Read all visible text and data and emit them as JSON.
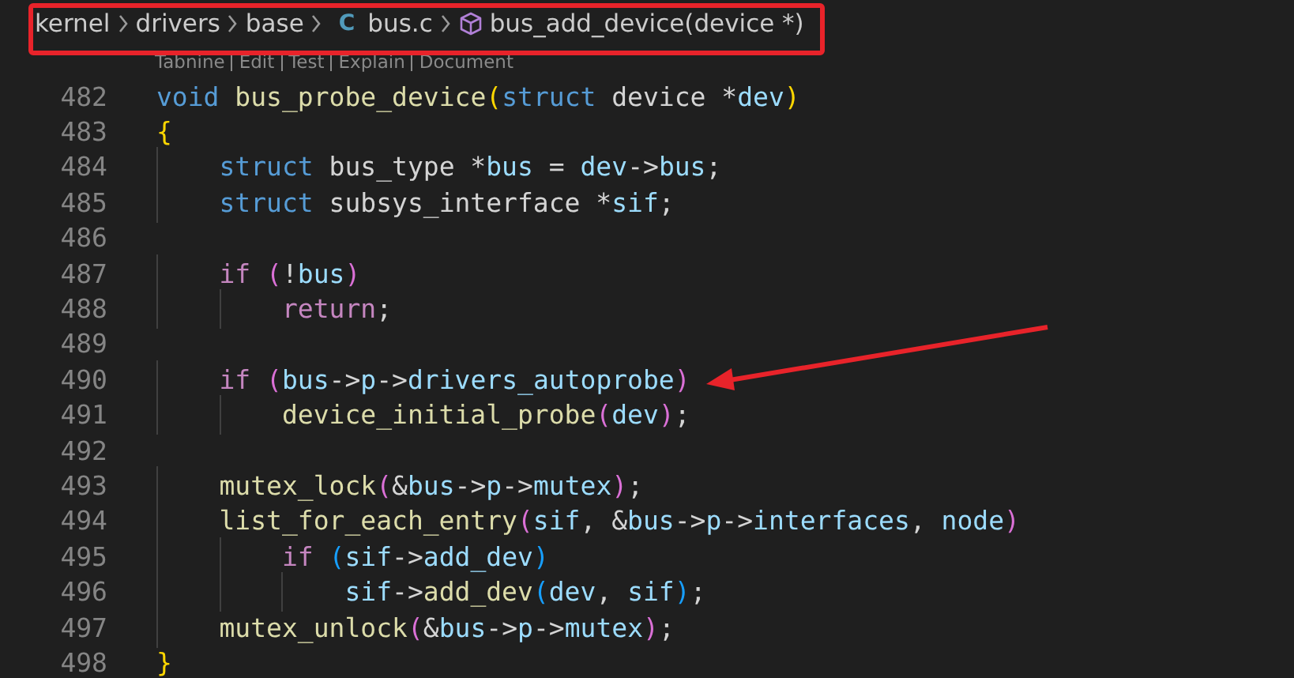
{
  "breadcrumb": [
    {
      "kind": "folder",
      "label": "kernel"
    },
    {
      "kind": "folder",
      "label": "drivers"
    },
    {
      "kind": "folder",
      "label": "base"
    },
    {
      "kind": "c-file",
      "glyph": "C",
      "label": "bus.c"
    },
    {
      "kind": "symbol",
      "label": "bus_add_device(device *)"
    }
  ],
  "codelens": [
    "Tabnine",
    "Edit",
    "Test",
    "Explain",
    "Document"
  ],
  "code_lines": [
    {
      "number": "482",
      "tokens": [
        {
          "kind": "keyword",
          "text": "void"
        },
        {
          "kind": "function",
          "text": " bus_probe_device"
        },
        {
          "kind": "bracket1",
          "text": "("
        },
        {
          "kind": "keyword",
          "text": "struct"
        },
        {
          "kind": "plain",
          "text": " device *"
        },
        {
          "kind": "variable",
          "text": "dev"
        },
        {
          "kind": "bracket1",
          "text": ")"
        }
      ]
    },
    {
      "number": "483",
      "tokens": [
        {
          "kind": "bracket1",
          "text": "{"
        }
      ]
    },
    {
      "number": "484",
      "tokens": [
        {
          "kind": "keyword",
          "text": "    struct"
        },
        {
          "kind": "plain",
          "text": " bus_type *"
        },
        {
          "kind": "variable",
          "text": "bus"
        },
        {
          "kind": "plain",
          "text": " = "
        },
        {
          "kind": "variable",
          "text": "dev"
        },
        {
          "kind": "plain",
          "text": "->"
        },
        {
          "kind": "variable",
          "text": "bus"
        },
        {
          "kind": "plain",
          "text": ";"
        }
      ]
    },
    {
      "number": "485",
      "tokens": [
        {
          "kind": "keyword",
          "text": "    struct"
        },
        {
          "kind": "plain",
          "text": " subsys_interface *"
        },
        {
          "kind": "variable",
          "text": "sif"
        },
        {
          "kind": "plain",
          "text": ";"
        }
      ]
    },
    {
      "number": "486"
    },
    {
      "number": "487",
      "tokens": [
        {
          "kind": "control",
          "text": "    if"
        },
        {
          "kind": "bracket2",
          "text": " ("
        },
        {
          "kind": "plain",
          "text": "!"
        },
        {
          "kind": "variable",
          "text": "bus"
        },
        {
          "kind": "bracket2",
          "text": ")"
        }
      ]
    },
    {
      "number": "488",
      "tokens": [
        {
          "kind": "control",
          "text": "        return"
        },
        {
          "kind": "plain",
          "text": ";"
        }
      ]
    },
    {
      "number": "489"
    },
    {
      "number": "490",
      "tokens": [
        {
          "kind": "control",
          "text": "    if"
        },
        {
          "kind": "bracket2",
          "text": " ("
        },
        {
          "kind": "variable",
          "text": "bus"
        },
        {
          "kind": "plain",
          "text": "->"
        },
        {
          "kind": "variable",
          "text": "p"
        },
        {
          "kind": "plain",
          "text": "->"
        },
        {
          "kind": "variable",
          "text": "drivers_autoprobe"
        },
        {
          "kind": "bracket2",
          "text": ")"
        }
      ]
    },
    {
      "number": "491",
      "tokens": [
        {
          "kind": "function",
          "text": "        device_initial_probe"
        },
        {
          "kind": "bracket2",
          "text": "("
        },
        {
          "kind": "variable",
          "text": "dev"
        },
        {
          "kind": "bracket2",
          "text": ")"
        },
        {
          "kind": "plain",
          "text": ";"
        }
      ]
    },
    {
      "number": "492"
    },
    {
      "number": "493",
      "tokens": [
        {
          "kind": "function",
          "text": "    mutex_lock"
        },
        {
          "kind": "bracket2",
          "text": "("
        },
        {
          "kind": "plain",
          "text": "&"
        },
        {
          "kind": "variable",
          "text": "bus"
        },
        {
          "kind": "plain",
          "text": "->"
        },
        {
          "kind": "variable",
          "text": "p"
        },
        {
          "kind": "plain",
          "text": "->"
        },
        {
          "kind": "variable",
          "text": "mutex"
        },
        {
          "kind": "bracket2",
          "text": ")"
        },
        {
          "kind": "plain",
          "text": ";"
        }
      ]
    },
    {
      "number": "494",
      "tokens": [
        {
          "kind": "function",
          "text": "    list_for_each_entry"
        },
        {
          "kind": "bracket2",
          "text": "("
        },
        {
          "kind": "variable",
          "text": "sif"
        },
        {
          "kind": "plain",
          "text": ", &"
        },
        {
          "kind": "variable",
          "text": "bus"
        },
        {
          "kind": "plain",
          "text": "->"
        },
        {
          "kind": "variable",
          "text": "p"
        },
        {
          "kind": "plain",
          "text": "->"
        },
        {
          "kind": "variable",
          "text": "interfaces"
        },
        {
          "kind": "plain",
          "text": ", "
        },
        {
          "kind": "variable",
          "text": "node"
        },
        {
          "kind": "bracket2",
          "text": ")"
        }
      ]
    },
    {
      "number": "495",
      "tokens": [
        {
          "kind": "control",
          "text": "        if"
        },
        {
          "kind": "bracket3",
          "text": " ("
        },
        {
          "kind": "variable",
          "text": "sif"
        },
        {
          "kind": "plain",
          "text": "->"
        },
        {
          "kind": "variable",
          "text": "add_dev"
        },
        {
          "kind": "bracket3",
          "text": ")"
        }
      ]
    },
    {
      "number": "496",
      "tokens": [
        {
          "kind": "variable",
          "text": "            sif"
        },
        {
          "kind": "plain",
          "text": "->"
        },
        {
          "kind": "function",
          "text": "add_dev"
        },
        {
          "kind": "bracket3",
          "text": "("
        },
        {
          "kind": "variable",
          "text": "dev"
        },
        {
          "kind": "plain",
          "text": ", "
        },
        {
          "kind": "variable",
          "text": "sif"
        },
        {
          "kind": "bracket3",
          "text": ")"
        },
        {
          "kind": "plain",
          "text": ";"
        }
      ]
    },
    {
      "number": "497",
      "tokens": [
        {
          "kind": "function",
          "text": "    mutex_unlock"
        },
        {
          "kind": "bracket2",
          "text": "("
        },
        {
          "kind": "plain",
          "text": "&"
        },
        {
          "kind": "variable",
          "text": "bus"
        },
        {
          "kind": "plain",
          "text": "->"
        },
        {
          "kind": "variable",
          "text": "p"
        },
        {
          "kind": "plain",
          "text": "->"
        },
        {
          "kind": "variable",
          "text": "mutex"
        },
        {
          "kind": "bracket2",
          "text": ")"
        },
        {
          "kind": "plain",
          "text": ";"
        }
      ]
    },
    {
      "number": "498",
      "tokens": [
        {
          "kind": "bracket1",
          "text": "}"
        }
      ]
    }
  ],
  "annotations": {
    "highlight_box": true,
    "arrow": true
  }
}
